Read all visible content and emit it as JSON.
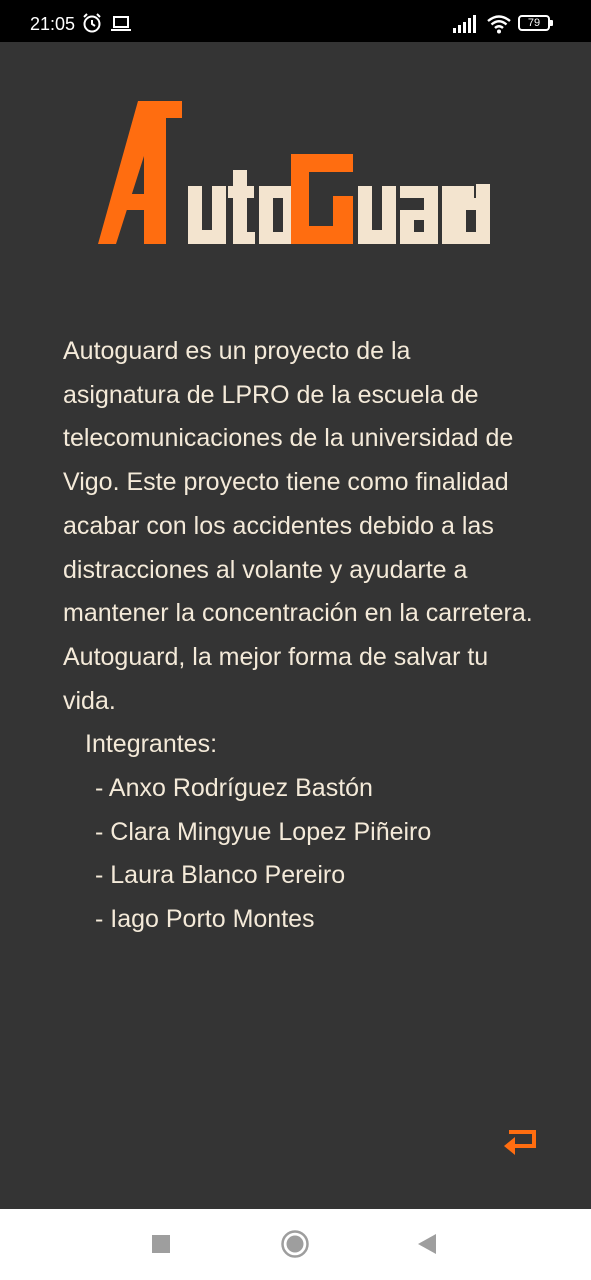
{
  "status_bar": {
    "time": "21:05",
    "battery": "79",
    "icons": [
      "alarm-icon",
      "laptop-icon",
      "signal-icon",
      "wifi-icon",
      "battery-icon"
    ]
  },
  "logo": {
    "text": "AutoGuard",
    "accent_color": "#ff6d10",
    "text_color": "#f3e4cf"
  },
  "about": {
    "description": " Autoguard es un proyecto de la asignatura de LPRO de la escuela de telecomunicaciones de la universidad de Vigo. Este proyecto tiene como finalidad acabar con los accidentes debido a las distracciones al volante y ayudarte a mantener la concentración en la carretera. Autoguard, la mejor forma de salvar tu vida.",
    "members_title": "Integrantes:",
    "members": [
      "- Anxo Rodríguez Bastón",
      "- Clara Mingyue Lopez Piñeiro",
      "- Laura Blanco Pereiro",
      "- Iago Porto Montes"
    ]
  },
  "back_button": {
    "icon": "return-arrow-icon",
    "color": "#ff6d10"
  },
  "nav_bar": {
    "buttons": [
      "recents-square-icon",
      "home-circle-icon",
      "back-triangle-icon"
    ]
  },
  "colors": {
    "background": "#343434",
    "text": "#f4ead9",
    "accent": "#ff6d10"
  }
}
